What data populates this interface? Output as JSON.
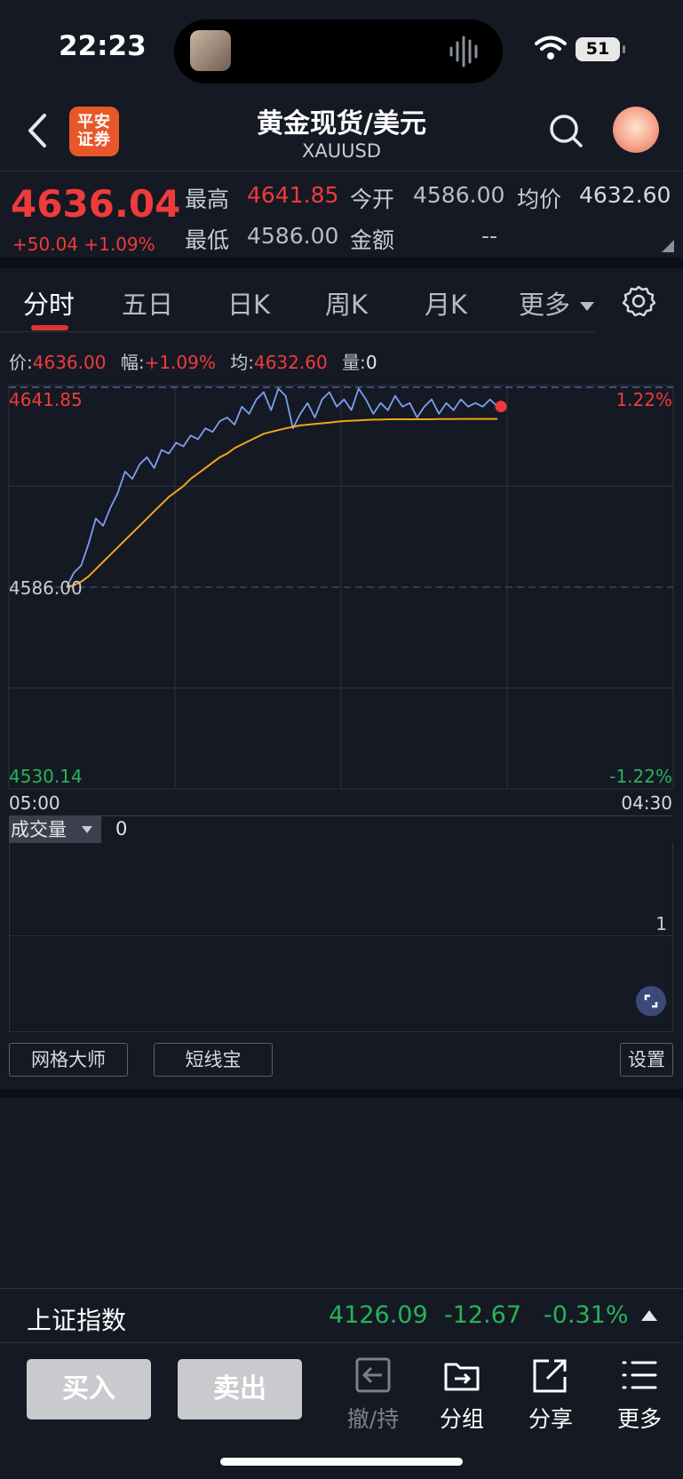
{
  "status_bar": {
    "time": "22:23",
    "battery": "51"
  },
  "header": {
    "logo_text": "平安证券",
    "title": "黄金现货/美元",
    "subtitle": "XAUUSD"
  },
  "quote": {
    "price": "4636.04",
    "change": "+50.04 +1.09%",
    "high_label": "最高",
    "high_value": "4641.85",
    "open_label": "今开",
    "open_value": "4586.00",
    "avg_label": "均价",
    "avg_value": "4632.60",
    "low_label": "最低",
    "low_value": "4586.00",
    "amount_label": "金额",
    "amount_value": "--"
  },
  "tabs": [
    {
      "label": "分时",
      "active": true
    },
    {
      "label": "五日",
      "active": false
    },
    {
      "label": "日K",
      "active": false
    },
    {
      "label": "周K",
      "active": false
    },
    {
      "label": "月K",
      "active": false
    },
    {
      "label": "更多",
      "active": false
    }
  ],
  "info_row": {
    "price_label": "价:",
    "price_value": "4636.00",
    "range_label": "幅:",
    "range_value": "+1.09%",
    "avg_label": "均:",
    "avg_value": "4632.60",
    "vol_label": "量:",
    "vol_value": "0"
  },
  "chart_data": {
    "type": "line",
    "x_start_label": "05:00",
    "x_end_label": "04:30",
    "y_max_label": "4641.85",
    "y_ref_label": "4586.00",
    "y_min_label": "4530.14",
    "pct_max_label": "1.22%",
    "pct_min_label": "-1.22%",
    "ylim": [
      4530.14,
      4641.85
    ],
    "reference_price": 4586.0,
    "series": [
      {
        "values": [
          4586,
          4590,
          4592,
          4598,
          4605,
          4603,
          4608,
          4612,
          4618,
          4616,
          4620,
          4622,
          4619,
          4624,
          4623,
          4626,
          4625,
          4628,
          4627,
          4630,
          4629,
          4632,
          4633,
          4631,
          4636,
          4634,
          4638,
          4640,
          4635,
          4641,
          4639,
          4630,
          4634,
          4637,
          4633,
          4638,
          4640,
          4636,
          4638,
          4635,
          4641,
          4638,
          4634,
          4637,
          4635,
          4639,
          4636,
          4637,
          4633,
          4636,
          4638,
          4634,
          4637,
          4635,
          4638,
          4636,
          4637,
          4636,
          4638,
          4636.04
        ],
        "color": "#7d9ff0"
      },
      {
        "values": [
          4586,
          4586.5,
          4587.5,
          4589,
          4591,
          4593,
          4595,
          4597,
          4599,
          4601,
          4603,
          4605,
          4607,
          4609,
          4611,
          4612.5,
          4614,
          4616,
          4617.5,
          4619,
          4620.5,
          4622,
          4623,
          4624.5,
          4625.5,
          4626.5,
          4627.5,
          4628.5,
          4629,
          4629.5,
          4630,
          4630.4,
          4630.8,
          4631,
          4631.2,
          4631.4,
          4631.6,
          4631.8,
          4632,
          4632.1,
          4632.2,
          4632.3,
          4632.4,
          4632.4,
          4632.5,
          4632.5,
          4632.5,
          4632.5,
          4632.5,
          4632.5,
          4632.5,
          4632.55,
          4632.55,
          4632.55,
          4632.6,
          4632.6,
          4632.6,
          4632.6,
          4632.6,
          4632.6
        ],
        "color": "#f2a51a"
      }
    ],
    "grid": true
  },
  "volume": {
    "selector_label": "成交量",
    "value": "0",
    "axis_label": "1"
  },
  "tools": {
    "grid_master": "网格大师",
    "short_line": "短线宝",
    "settings": "设置"
  },
  "index_bar": {
    "name": "上证指数",
    "value": "4126.09",
    "change": "-12.67",
    "pct": "-0.31%"
  },
  "bottom": {
    "buy": "买入",
    "sell": "卖出",
    "cancel_hold": "撤/持",
    "group": "分组",
    "share": "分享",
    "more": "更多"
  },
  "colors": {
    "up": "#ef3b3b",
    "down": "#27b35a",
    "price_line": "#7d9ff0",
    "avg_line": "#f2a51a",
    "background": "#151923"
  }
}
